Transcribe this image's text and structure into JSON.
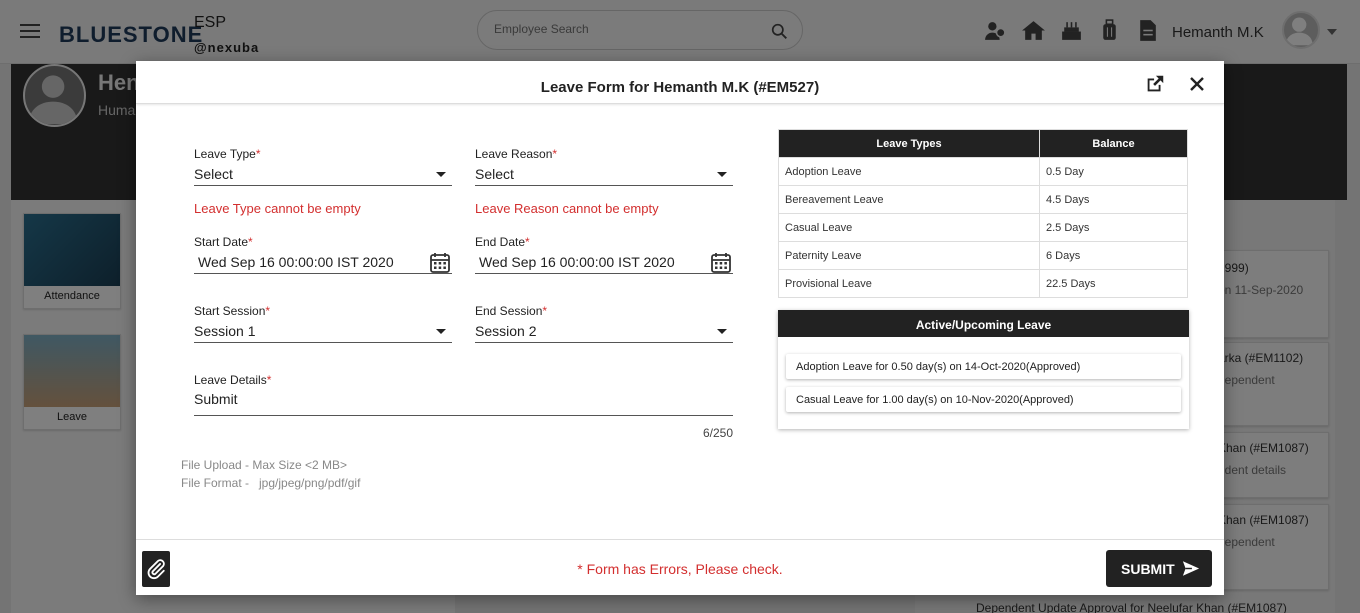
{
  "topbar": {
    "brand": "BLUESTONE",
    "app_name": "ESP",
    "org": "@nexuba",
    "search_placeholder": "Employee Search",
    "user_name": "Hemanth M.K"
  },
  "banner": {
    "name": "Hen",
    "role": "Huma"
  },
  "tiles": {
    "attendance": "Attendance",
    "leave": "Leave"
  },
  "right_cards": [
    {
      "line1": "1999)",
      "line2": "on 11-Sep-2020"
    },
    {
      "line1": "arka (#EM1102)",
      "line2": "dependent"
    },
    {
      "line1": "Khan (#EM1087)",
      "line2": "ndent details"
    },
    {
      "line1": "Khan (#EM1087)",
      "line2": "dependent"
    }
  ],
  "bottom_strip": "Dependent Update Approval for Neelufar Khan (#EM1087)",
  "modal": {
    "title": "Leave Form for Hemanth M.K (#EM527)",
    "leave_type": {
      "label": "Leave Type",
      "value": "Select",
      "error": "Leave Type cannot be empty"
    },
    "leave_reason": {
      "label": "Leave Reason",
      "value": "Select",
      "error": "Leave Reason cannot be empty"
    },
    "start_date": {
      "label": "Start Date",
      "value": "Wed Sep 16 00:00:00 IST 2020"
    },
    "end_date": {
      "label": "End Date",
      "value": "Wed Sep 16 00:00:00 IST 2020"
    },
    "start_session": {
      "label": "Start Session",
      "value": "Session 1"
    },
    "end_session": {
      "label": "End Session",
      "value": "Session 2"
    },
    "leave_details": {
      "label": "Leave Details",
      "value": "Submit",
      "counter": "6/250"
    },
    "upload": {
      "size_note": "File Upload - Max Size <2 MB>",
      "format_note": "File Format -   jpg/jpeg/png/pdf/gif"
    },
    "required_mark": "*",
    "balance_table": {
      "headers": [
        "Leave Types",
        "Balance"
      ],
      "rows": [
        [
          "Adoption Leave",
          "0.5 Day"
        ],
        [
          "Bereavement Leave",
          "4.5 Days"
        ],
        [
          "Casual Leave",
          "2.5 Days"
        ],
        [
          "Paternity Leave",
          "6 Days"
        ],
        [
          "Provisional Leave",
          "22.5 Days"
        ]
      ]
    },
    "active_leave": {
      "title": "Active/Upcoming Leave",
      "items": [
        "Adoption Leave for 0.50 day(s) on 14-Oct-2020(Approved)",
        "Casual Leave for 1.00 day(s) on 10-Nov-2020(Approved)"
      ]
    },
    "footer": {
      "error": "* Form has Errors, Please check.",
      "submit_label": "SUBMIT"
    }
  },
  "colors": {
    "error": "#d32f2f",
    "dark": "#222222",
    "brand": "#1f3a5a"
  }
}
